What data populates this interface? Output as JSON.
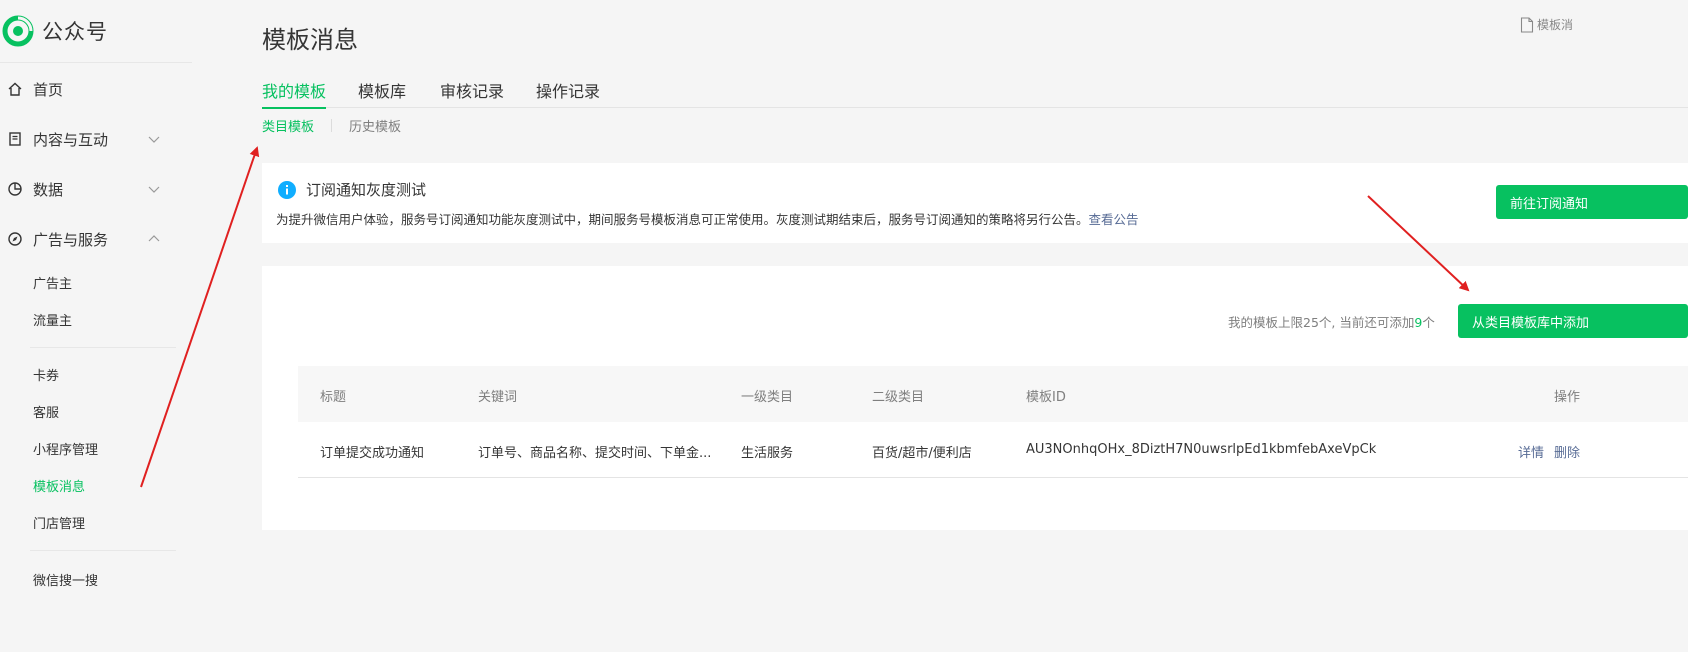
{
  "brand": {
    "name": "公众号",
    "logo_icon": "wechat-official-account-logo",
    "color": "#07c160"
  },
  "sidebar": {
    "top_items": [
      {
        "label": "首页",
        "icon": "home-icon"
      },
      {
        "label": "内容与互动",
        "icon": "document-icon",
        "expand": "chevron-down-icon"
      },
      {
        "label": "数据",
        "icon": "pie-chart-icon",
        "expand": "chevron-down-icon"
      },
      {
        "label": "广告与服务",
        "icon": "compass-icon",
        "expand": "chevron-up-icon"
      }
    ],
    "group1": [
      "广告主",
      "流量主"
    ],
    "group2": [
      "卡券",
      "客服",
      "小程序管理",
      "模板消息",
      "门店管理"
    ],
    "group3": [
      "微信搜一搜"
    ],
    "active_item": "模板消息"
  },
  "header": {
    "title": "模板消息",
    "top_right_label": "模板消"
  },
  "tabs": [
    {
      "label": "我的模板",
      "active": true
    },
    {
      "label": "模板库",
      "active": false
    },
    {
      "label": "审核记录",
      "active": false
    },
    {
      "label": "操作记录",
      "active": false
    }
  ],
  "subtabs": [
    {
      "label": "类目模板",
      "active": true
    },
    {
      "label": "历史模板",
      "active": false
    }
  ],
  "notice": {
    "title": "订阅通知灰度测试",
    "icon": "info-icon",
    "desc": "为提升微信用户体验，服务号订阅通知功能灰度测试中，期间服务号模板消息可正常使用。灰度测试期结束后，服务号订阅通知的策略将另行公告。",
    "link": "查看公告",
    "button": "前往订阅通知"
  },
  "quota": {
    "prefix": "我的模板上限25个, 当前还可添加",
    "remaining": "9",
    "suffix": "个"
  },
  "add_button": "从类目模板库中添加",
  "table": {
    "headers": [
      "标题",
      "关键词",
      "一级类目",
      "二级类目",
      "模板ID",
      "操作"
    ],
    "rows": [
      {
        "title": "订单提交成功通知",
        "keywords": "订单号、商品名称、提交时间、下单金...",
        "cat1": "生活服务",
        "cat2": "百货/超市/便利店",
        "template_id": "AU3NOnhqOHx_8DiztH7N0uwsrlpEd1kbmfebAxeVpCk",
        "actions": [
          "详情",
          "删除"
        ]
      }
    ]
  },
  "colors": {
    "accent": "#07c160",
    "link": "#576b95",
    "annotation": "#e02020"
  }
}
